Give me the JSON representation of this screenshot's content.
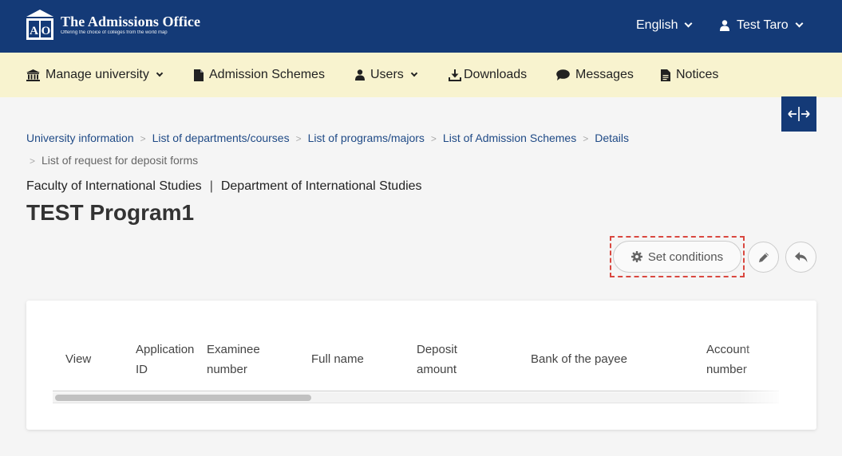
{
  "header": {
    "logo_title": "The Admissions Office",
    "logo_tagline": "Offering the choice of colleges from the world map",
    "logo_mark_text": "AO",
    "language": "English",
    "user": "Test Taro",
    "bg_color": "#143a77"
  },
  "nav": {
    "bg_color": "#f8f3cf",
    "items": [
      {
        "label": "Manage university",
        "icon": "university-icon",
        "dropdown": true
      },
      {
        "label": "Admission Schemes",
        "icon": "document-icon",
        "dropdown": false
      },
      {
        "label": "Users",
        "icon": "user-icon",
        "dropdown": true
      },
      {
        "label": "Downloads",
        "icon": "download-icon",
        "dropdown": false
      },
      {
        "label": "Messages",
        "icon": "chat-bubble-icon",
        "dropdown": false
      },
      {
        "label": "Notices",
        "icon": "document-icon",
        "dropdown": false
      }
    ]
  },
  "breadcrumb": {
    "items": [
      "University information",
      "List of departments/courses",
      "List of programs/majors",
      "List of Admission Schemes",
      "Details"
    ],
    "current": "List of request for deposit forms",
    "separator": ">"
  },
  "page": {
    "faculty": "Faculty of International Studies",
    "department": "Department of International Studies",
    "title": "TEST Program1"
  },
  "actions": {
    "set_conditions": "Set conditions",
    "highlight_color": "#d9473f"
  },
  "table": {
    "columns": [
      {
        "line1": "",
        "line2": "View"
      },
      {
        "line1": "Application",
        "line2": "ID"
      },
      {
        "line1": "Examinee",
        "line2": "number"
      },
      {
        "line1": "",
        "line2": "Full name"
      },
      {
        "line1": "Deposit",
        "line2": "amount"
      },
      {
        "line1": "",
        "line2": "Bank of the payee"
      },
      {
        "line1": "Account",
        "line2": "number"
      }
    ],
    "rows": []
  }
}
